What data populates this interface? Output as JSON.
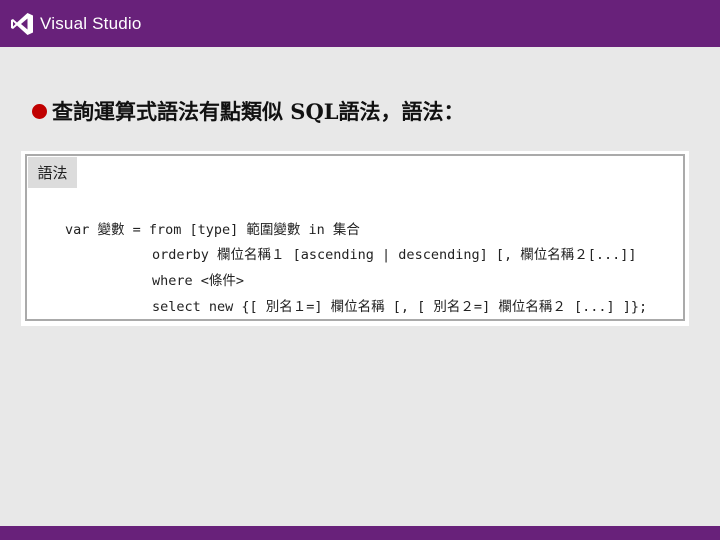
{
  "header": {
    "brand": "Visual Studio",
    "logo_icon": "visual-studio-logo-icon",
    "bar_color": "#68217a"
  },
  "slide": {
    "bullet_text": "查詢運算式語法有點類似 SQL語法，語法：",
    "bullet_color": "#c00000"
  },
  "syntax_box": {
    "label": "語法",
    "code_lines": [
      "var 變數 = from [type] 範圍變數 in 集合",
      "orderby 欄位名稱１ [ascending | descending] [, 欄位名稱２[...]]",
      "where <條件>",
      "select new {[ 別名１=] 欄位名稱 [, [ 別名２=] 欄位名稱２ [...] ]};"
    ]
  }
}
